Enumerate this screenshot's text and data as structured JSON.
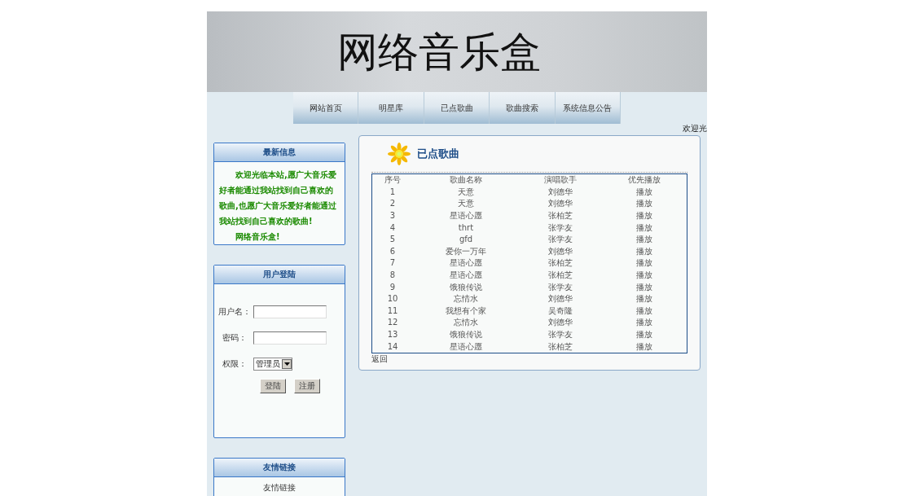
{
  "banner": {
    "title": "网络音乐盒"
  },
  "nav": [
    {
      "label": "网站首页"
    },
    {
      "label": "明星库"
    },
    {
      "label": "已点歌曲"
    },
    {
      "label": "歌曲搜索"
    },
    {
      "label": "系统信息公告"
    }
  ],
  "welcome": "欢迎光",
  "news": {
    "title": "最新信息",
    "text": "欢迎光临本站,愿广大音乐爱好者能通过我站找到自己喜欢的歌曲,也愿广大音乐爱好者能通过我站找到自己喜欢的歌曲!",
    "sign": "网络音乐盒!"
  },
  "login": {
    "title": "用户登陆",
    "username_label": "用户名：",
    "password_label": "密码：",
    "role_label": "权限：",
    "role_value": "管理员",
    "buttons": [
      "登陆",
      "注册"
    ]
  },
  "links": {
    "title": "友情链接",
    "item": "友情链接"
  },
  "songs": {
    "title": "已点歌曲",
    "columns": [
      "序号",
      "歌曲名称",
      "演唱歌手",
      "优先播放"
    ],
    "rows": [
      [
        "1",
        "天意",
        "刘德华",
        "播放"
      ],
      [
        "2",
        "天意",
        "刘德华",
        "播放"
      ],
      [
        "3",
        "星语心愿",
        "张柏芝",
        "播放"
      ],
      [
        "4",
        "thrt",
        "张学友",
        "播放"
      ],
      [
        "5",
        "gfd",
        "张学友",
        "播放"
      ],
      [
        "6",
        "爱你一万年",
        "刘德华",
        "播放"
      ],
      [
        "7",
        "星语心愿",
        "张柏芝",
        "播放"
      ],
      [
        "8",
        "星语心愿",
        "张柏芝",
        "播放"
      ],
      [
        "9",
        "饿狼传说",
        "张学友",
        "播放"
      ],
      [
        "10",
        "忘情水",
        "刘德华",
        "播放"
      ],
      [
        "11",
        "我想有个家",
        "吴奇隆",
        "播放"
      ],
      [
        "12",
        "忘情水",
        "刘德华",
        "播放"
      ],
      [
        "13",
        "饿狼传说",
        "张学友",
        "播放"
      ],
      [
        "14",
        "星语心愿",
        "张柏芝",
        "播放"
      ]
    ],
    "back": "返回"
  }
}
